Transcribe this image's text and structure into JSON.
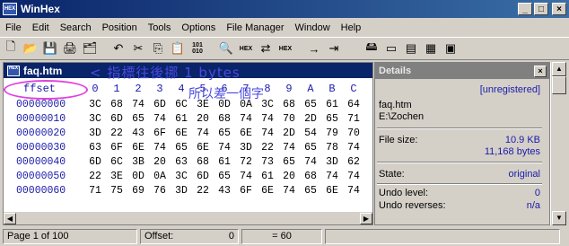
{
  "window": {
    "title": "WinHex",
    "icon_text": "HEX",
    "min": "_",
    "max": "□",
    "close": "×"
  },
  "menu": [
    {
      "label": "File"
    },
    {
      "label": "Edit"
    },
    {
      "label": "Search"
    },
    {
      "label": "Position"
    },
    {
      "label": "Tools"
    },
    {
      "label": "Options"
    },
    {
      "label": "File Manager"
    },
    {
      "label": "Window"
    },
    {
      "label": "Help"
    }
  ],
  "toolbar": {
    "new": "🗋",
    "open": "📂",
    "save": "💾",
    "print": "🖨",
    "properties": "🗂",
    "undo": "↶",
    "cut": "✂",
    "copy": "⎘",
    "paste": "📋",
    "binary": "101\n010",
    "find": "🔍",
    "find_hex": "HEX",
    "replace": "⇄",
    "replace_hex": "HEX",
    "goto_offset": "→",
    "goto_page": "⇥",
    "disk_tools": "🖴",
    "windows_tools": "▭",
    "ram_tools": "▤",
    "calculator": "▦",
    "ram_editor": "▣"
  },
  "document": {
    "title": "faq.htm",
    "offset_header": "ffset",
    "columns": [
      "0",
      "1",
      "2",
      "3",
      "4",
      "5",
      "6",
      "7",
      "8",
      "9",
      "A",
      "B",
      "C"
    ],
    "rows": [
      {
        "offset": "00000000",
        "bytes": [
          "3C",
          "68",
          "74",
          "6D",
          "6C",
          "3E",
          "0D",
          "0A",
          "3C",
          "68",
          "65",
          "61",
          "64"
        ]
      },
      {
        "offset": "00000010",
        "bytes": [
          "3C",
          "6D",
          "65",
          "74",
          "61",
          "20",
          "68",
          "74",
          "74",
          "70",
          "2D",
          "65",
          "71"
        ]
      },
      {
        "offset": "00000020",
        "bytes": [
          "3D",
          "22",
          "43",
          "6F",
          "6E",
          "74",
          "65",
          "6E",
          "74",
          "2D",
          "54",
          "79",
          "70"
        ]
      },
      {
        "offset": "00000030",
        "bytes": [
          "63",
          "6F",
          "6E",
          "74",
          "65",
          "6E",
          "74",
          "3D",
          "22",
          "74",
          "65",
          "78",
          "74"
        ]
      },
      {
        "offset": "00000040",
        "bytes": [
          "6D",
          "6C",
          "3B",
          "20",
          "63",
          "68",
          "61",
          "72",
          "73",
          "65",
          "74",
          "3D",
          "62"
        ]
      },
      {
        "offset": "00000050",
        "bytes": [
          "22",
          "3E",
          "0D",
          "0A",
          "3C",
          "6D",
          "65",
          "74",
          "61",
          "20",
          "68",
          "74",
          "74"
        ]
      },
      {
        "offset": "00000060",
        "bytes": [
          "71",
          "75",
          "69",
          "76",
          "3D",
          "22",
          "43",
          "6F",
          "6E",
          "74",
          "65",
          "6E",
          "74"
        ]
      }
    ],
    "annotation_line1": "< 指標往後挪 1 bytes",
    "annotation_line2": "所以差一個字"
  },
  "details": {
    "header": "Details",
    "license": "[unregistered]",
    "filename": "faq.htm",
    "path": "E:\\Zochen",
    "file_size_label": "File size:",
    "file_size_kb": "10.9 KB",
    "file_size_bytes": "11,168 bytes",
    "state_label": "State:",
    "state_value": "original",
    "undo_level_label": "Undo level:",
    "undo_level_value": "0",
    "undo_reverses_label": "Undo reverses:",
    "undo_reverses_value": "n/a"
  },
  "status": {
    "page": "Page 1 of 100",
    "offset_label": "Offset:",
    "offset_value": "0",
    "value": "= 60"
  }
}
